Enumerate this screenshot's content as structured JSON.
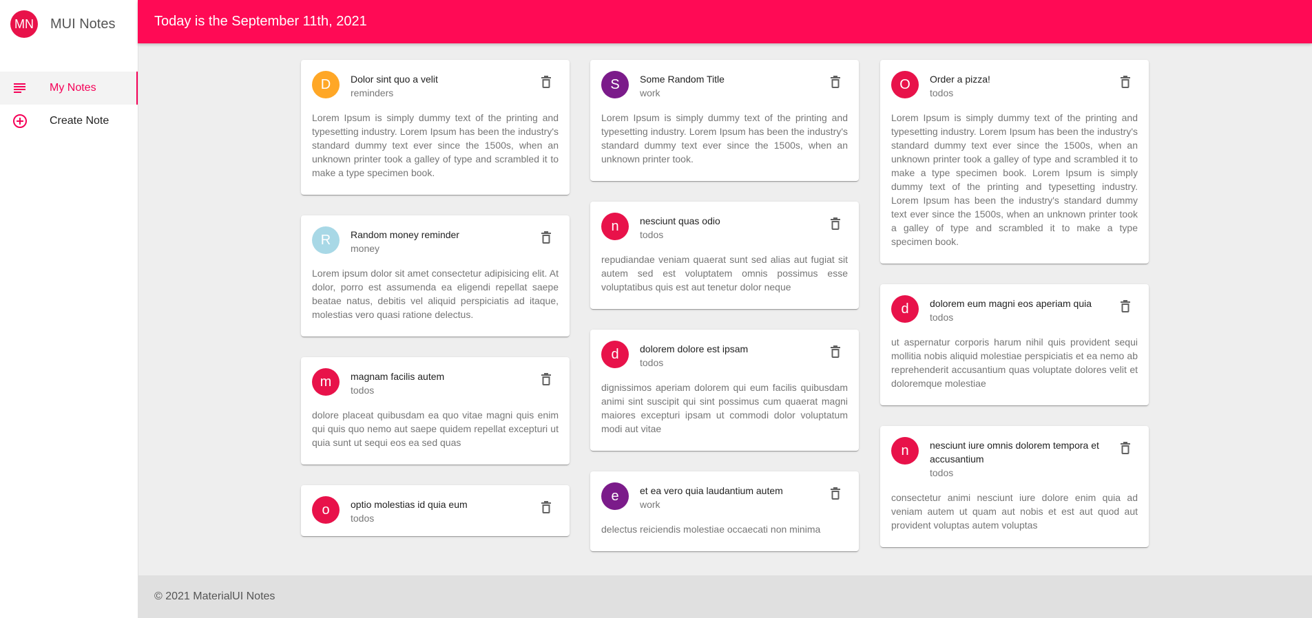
{
  "app": {
    "brand_avatar": "MN",
    "brand_title": "MUI Notes",
    "accent": "#f50057"
  },
  "sidebar": {
    "items": [
      {
        "label": "My Notes",
        "icon": "subject-icon",
        "active": true
      },
      {
        "label": "Create Note",
        "icon": "add-circle-icon",
        "active": false
      }
    ]
  },
  "header": {
    "date_text": "Today is the September 11th, 2021"
  },
  "columns": [
    [
      {
        "avatar": "D",
        "color": "#ffa726",
        "title": "Dolor sint quo a velit",
        "category": "reminders",
        "body": "Lorem Ipsum is simply dummy text of the printing and typesetting industry. Lorem Ipsum has been the industry's standard dummy text ever since the 1500s, when an unknown printer took a galley of type and scrambled it to make a type specimen book."
      },
      {
        "avatar": "R",
        "color": "#a8d8e6",
        "title": "Random money reminder",
        "category": "money",
        "body": "Lorem ipsum dolor sit amet consectetur adipisicing elit. At dolor, porro est assumenda ea eligendi repellat saepe beatae natus, debitis vel aliquid perspiciatis ad itaque, molestias vero quasi ratione delectus."
      },
      {
        "avatar": "m",
        "color": "#e8124a",
        "title": "magnam facilis autem",
        "category": "todos",
        "body": "dolore placeat quibusdam ea quo vitae magni quis enim qui quis quo nemo aut saepe quidem repellat excepturi ut quia sunt ut sequi eos ea sed quas"
      },
      {
        "avatar": "o",
        "color": "#e8124a",
        "title": "optio molestias id quia eum",
        "category": "todos",
        "body": ""
      }
    ],
    [
      {
        "avatar": "S",
        "color": "#7b1b8a",
        "title": "Some Random Title",
        "category": "work",
        "body": "Lorem Ipsum is simply dummy text of the printing and typesetting industry. Lorem Ipsum has been the industry's standard dummy text ever since the 1500s, when an unknown printer took."
      },
      {
        "avatar": "n",
        "color": "#e8124a",
        "title": "nesciunt quas odio",
        "category": "todos",
        "body": "repudiandae veniam quaerat sunt sed alias aut fugiat sit autem sed est voluptatem omnis possimus esse voluptatibus quis est aut tenetur dolor neque"
      },
      {
        "avatar": "d",
        "color": "#e8124a",
        "title": "dolorem dolore est ipsam",
        "category": "todos",
        "body": "dignissimos aperiam dolorem qui eum facilis quibusdam animi sint suscipit qui sint possimus cum quaerat magni maiores excepturi ipsam ut commodi dolor voluptatum modi aut vitae"
      },
      {
        "avatar": "e",
        "color": "#7b1b8a",
        "title": "et ea vero quia laudantium autem",
        "category": "work",
        "body": "delectus reiciendis molestiae occaecati non minima"
      }
    ],
    [
      {
        "avatar": "O",
        "color": "#e8124a",
        "title": "Order a pizza!",
        "category": "todos",
        "body": "Lorem Ipsum is simply dummy text of the printing and typesetting industry. Lorem Ipsum has been the industry's standard dummy text ever since the 1500s, when an unknown printer took a galley of type and scrambled it to make a type specimen book. Lorem Ipsum is simply dummy text of the printing and typesetting industry. Lorem Ipsum has been the industry's standard dummy text ever since the 1500s, when an unknown printer took a galley of type and scrambled it to make a type specimen book."
      },
      {
        "avatar": "d",
        "color": "#e8124a",
        "title": "dolorem eum magni eos aperiam quia",
        "category": "todos",
        "body": "ut aspernatur corporis harum nihil quis provident sequi mollitia nobis aliquid molestiae perspiciatis et ea nemo ab reprehenderit accusantium quas voluptate dolores velit et doloremque molestiae"
      },
      {
        "avatar": "n",
        "color": "#e8124a",
        "title": "nesciunt iure omnis dolorem tempora et accusantium",
        "category": "todos",
        "body": "consectetur animi nesciunt iure dolore enim quia ad veniam autem ut quam aut nobis et est aut quod aut provident voluptas autem voluptas"
      }
    ]
  ],
  "footer": {
    "text": "© 2021 MaterialUI Notes"
  }
}
